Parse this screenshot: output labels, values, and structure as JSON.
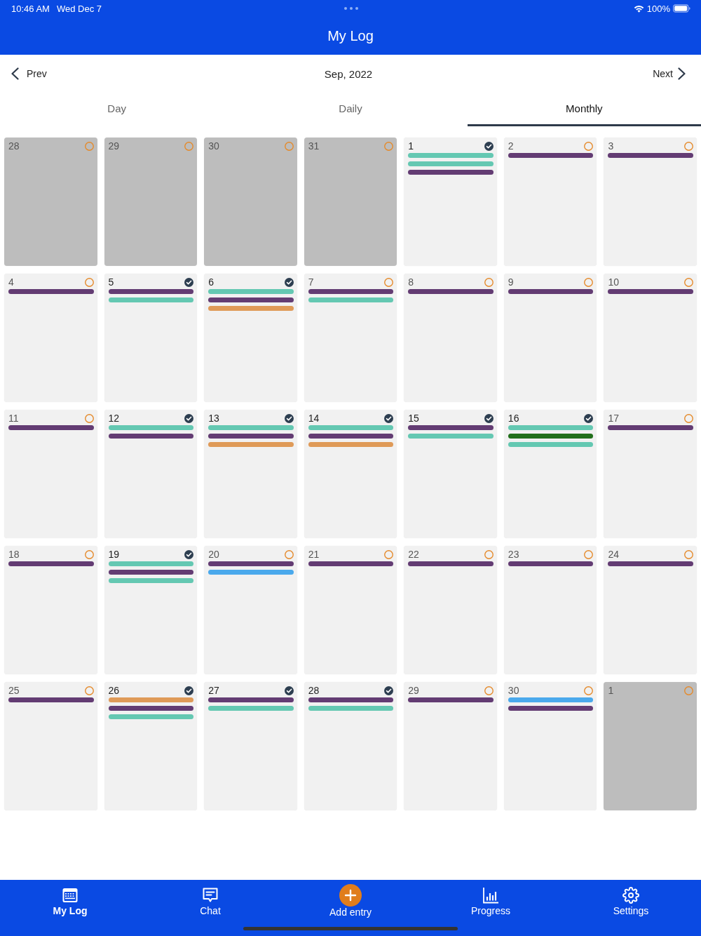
{
  "status_bar": {
    "time": "10:46 AM",
    "date": "Wed Dec 7",
    "battery": "100%"
  },
  "header": {
    "title": "My Log"
  },
  "navigator": {
    "prev": "Prev",
    "month": "Sep, 2022",
    "next": "Next"
  },
  "tabs": [
    {
      "label": "Day",
      "selected": false
    },
    {
      "label": "Daily",
      "selected": false
    },
    {
      "label": "Monthly",
      "selected": true
    }
  ],
  "calendar": {
    "days": [
      {
        "day": "28",
        "in_month": false,
        "completed": false
      },
      {
        "day": "29",
        "in_month": false,
        "completed": false
      },
      {
        "day": "30",
        "in_month": false,
        "completed": false
      },
      {
        "day": "31",
        "in_month": false,
        "completed": false
      },
      {
        "day": "1",
        "in_month": true,
        "completed": true,
        "entries": [
          {
            "color": "#64c8b2"
          },
          {
            "color": "#64c8b2"
          },
          {
            "color": "#633c73"
          }
        ]
      },
      {
        "day": "2",
        "in_month": true,
        "completed": false,
        "entries": [
          {
            "color": "#633c73"
          }
        ]
      },
      {
        "day": "3",
        "in_month": true,
        "completed": false,
        "entries": [
          {
            "color": "#633c73"
          }
        ]
      },
      {
        "day": "4",
        "in_month": true,
        "completed": false,
        "entries": [
          {
            "color": "#633c73"
          }
        ]
      },
      {
        "day": "5",
        "in_month": true,
        "completed": true,
        "entries": [
          {
            "color": "#633c73"
          },
          {
            "color": "#64c8b2"
          }
        ]
      },
      {
        "day": "6",
        "in_month": true,
        "completed": true,
        "entries": [
          {
            "color": "#64c8b2"
          },
          {
            "color": "#633c73"
          },
          {
            "color": "#df9a58"
          }
        ]
      },
      {
        "day": "7",
        "in_month": true,
        "completed": false,
        "entries": [
          {
            "color": "#633c73"
          },
          {
            "color": "#64c8b2"
          }
        ]
      },
      {
        "day": "8",
        "in_month": true,
        "completed": false,
        "entries": [
          {
            "color": "#633c73"
          }
        ]
      },
      {
        "day": "9",
        "in_month": true,
        "completed": false,
        "entries": [
          {
            "color": "#633c73"
          }
        ]
      },
      {
        "day": "10",
        "in_month": true,
        "completed": false,
        "entries": [
          {
            "color": "#633c73"
          }
        ]
      },
      {
        "day": "11",
        "in_month": true,
        "completed": false,
        "entries": [
          {
            "color": "#633c73"
          }
        ]
      },
      {
        "day": "12",
        "in_month": true,
        "completed": true,
        "entries": [
          {
            "color": "#64c8b2"
          },
          {
            "color": "#633c73"
          }
        ]
      },
      {
        "day": "13",
        "in_month": true,
        "completed": true,
        "entries": [
          {
            "color": "#64c8b2"
          },
          {
            "color": "#633c73"
          },
          {
            "color": "#df9a58"
          }
        ]
      },
      {
        "day": "14",
        "in_month": true,
        "completed": true,
        "entries": [
          {
            "color": "#64c8b2"
          },
          {
            "color": "#633c73"
          },
          {
            "color": "#df9a58"
          }
        ]
      },
      {
        "day": "15",
        "in_month": true,
        "completed": true,
        "entries": [
          {
            "color": "#633c73"
          },
          {
            "color": "#64c8b2"
          }
        ]
      },
      {
        "day": "16",
        "in_month": true,
        "completed": true,
        "entries": [
          {
            "color": "#64c8b2"
          },
          {
            "color": "#22701c"
          },
          {
            "color": "#64c8b2"
          }
        ]
      },
      {
        "day": "17",
        "in_month": true,
        "completed": false,
        "entries": [
          {
            "color": "#633c73"
          }
        ]
      },
      {
        "day": "18",
        "in_month": true,
        "completed": false,
        "entries": [
          {
            "color": "#633c73"
          }
        ]
      },
      {
        "day": "19",
        "in_month": true,
        "completed": true,
        "entries": [
          {
            "color": "#64c8b2"
          },
          {
            "color": "#633c73"
          },
          {
            "color": "#64c8b2"
          }
        ]
      },
      {
        "day": "20",
        "in_month": true,
        "completed": false,
        "entries": [
          {
            "color": "#633c73"
          },
          {
            "color": "#4aa9ec"
          }
        ]
      },
      {
        "day": "21",
        "in_month": true,
        "completed": false,
        "entries": [
          {
            "color": "#633c73"
          }
        ]
      },
      {
        "day": "22",
        "in_month": true,
        "completed": false,
        "entries": [
          {
            "color": "#633c73"
          }
        ]
      },
      {
        "day": "23",
        "in_month": true,
        "completed": false,
        "entries": [
          {
            "color": "#633c73"
          }
        ]
      },
      {
        "day": "24",
        "in_month": true,
        "completed": false,
        "entries": [
          {
            "color": "#633c73"
          }
        ]
      },
      {
        "day": "25",
        "in_month": true,
        "completed": false,
        "entries": [
          {
            "color": "#633c73"
          }
        ]
      },
      {
        "day": "26",
        "in_month": true,
        "completed": true,
        "entries": [
          {
            "color": "#df9a58"
          },
          {
            "color": "#633c73"
          },
          {
            "color": "#64c8b2"
          }
        ]
      },
      {
        "day": "27",
        "in_month": true,
        "completed": true,
        "entries": [
          {
            "color": "#633c73"
          },
          {
            "color": "#64c8b2"
          }
        ]
      },
      {
        "day": "28",
        "in_month": true,
        "completed": true,
        "entries": [
          {
            "color": "#633c73"
          },
          {
            "color": "#64c8b2"
          }
        ]
      },
      {
        "day": "29",
        "in_month": true,
        "completed": false,
        "entries": [
          {
            "color": "#633c73"
          }
        ]
      },
      {
        "day": "30",
        "in_month": true,
        "completed": false,
        "entries": [
          {
            "color": "#4aa9ec"
          },
          {
            "color": "#633c73"
          }
        ]
      },
      {
        "day": "1",
        "in_month": false,
        "completed": false
      }
    ]
  },
  "tab_bar": [
    {
      "label": "My Log",
      "kind": "tab",
      "selected": true
    },
    {
      "label": "Chat",
      "kind": "tab",
      "selected": false
    },
    {
      "label": "Add entry",
      "kind": "action",
      "selected": false
    },
    {
      "label": "Progress",
      "kind": "tab",
      "selected": false
    },
    {
      "label": "Settings",
      "kind": "tab",
      "selected": false
    }
  ]
}
